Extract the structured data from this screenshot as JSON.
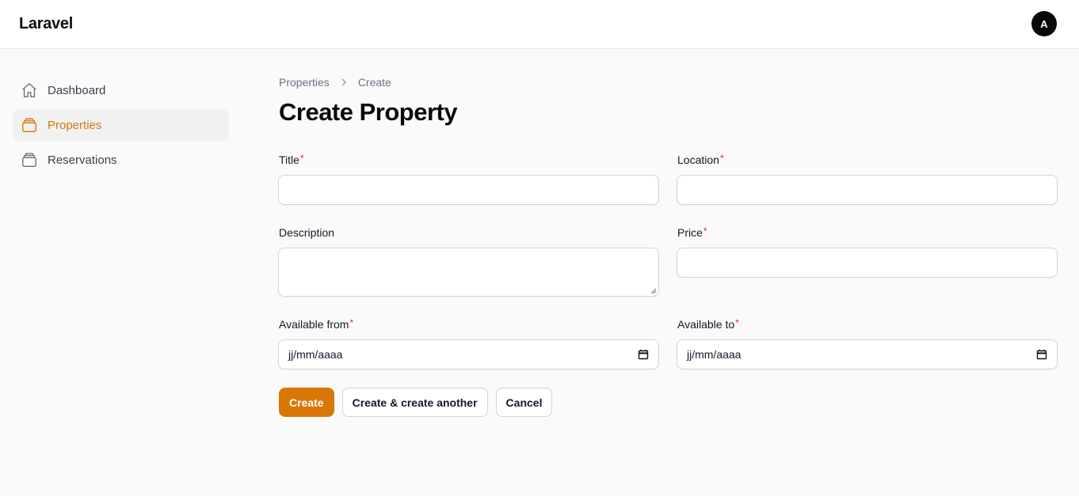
{
  "header": {
    "brand": "Laravel",
    "avatar_initial": "A"
  },
  "sidebar": {
    "items": [
      {
        "label": "Dashboard",
        "icon": "home-icon",
        "active": false
      },
      {
        "label": "Properties",
        "icon": "stack-icon",
        "active": true
      },
      {
        "label": "Reservations",
        "icon": "stack-icon",
        "active": false
      }
    ]
  },
  "breadcrumb": {
    "parent": "Properties",
    "current": "Create"
  },
  "page": {
    "title": "Create Property"
  },
  "form": {
    "title": {
      "label": "Title",
      "required_mark": "*",
      "value": ""
    },
    "location": {
      "label": "Location",
      "required_mark": "*",
      "value": ""
    },
    "description": {
      "label": "Description",
      "value": ""
    },
    "price": {
      "label": "Price",
      "required_mark": "*",
      "value": ""
    },
    "available_from": {
      "label": "Available from",
      "required_mark": "*",
      "placeholder": "jj/mm/aaaa"
    },
    "available_to": {
      "label": "Available to",
      "required_mark": "*",
      "placeholder": "jj/mm/aaaa"
    }
  },
  "actions": {
    "create": "Create",
    "create_another": "Create & create another",
    "cancel": "Cancel"
  },
  "colors": {
    "accent": "#d97706",
    "required": "#dc2626"
  }
}
